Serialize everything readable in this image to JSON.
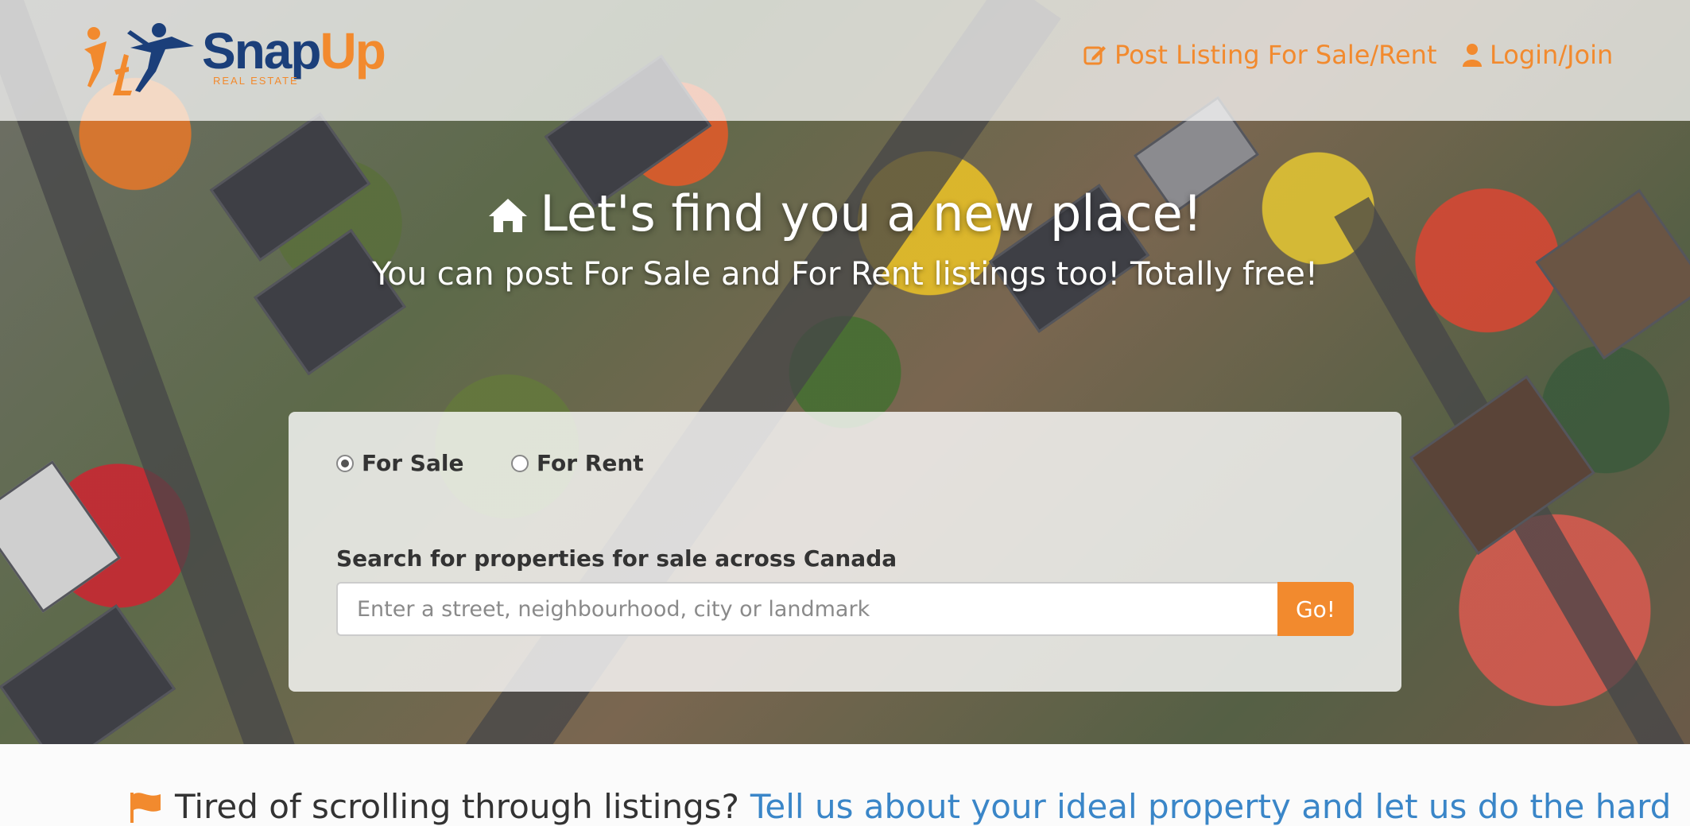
{
  "brand": {
    "name_part1": "Snap",
    "name_part2": "Up",
    "tagline": "REAL ESTATE",
    "primary_color": "#1b3f7a",
    "accent_color": "#f28a2e"
  },
  "nav": {
    "post_listing": {
      "label": "Post Listing For Sale/Rent",
      "icon": "edit-icon"
    },
    "login": {
      "label": "Login/Join",
      "icon": "user-icon"
    }
  },
  "hero": {
    "title": "Let's find you a new place!",
    "title_icon": "home-icon",
    "subtitle": "You can post For Sale and For Rent listings too! Totally free!"
  },
  "search": {
    "options": [
      {
        "label": "For Sale",
        "checked": true
      },
      {
        "label": "For Rent",
        "checked": false
      }
    ],
    "label": "Search for properties for sale across Canada",
    "placeholder": "Enter a street, neighbourhood, city or landmark",
    "value": "",
    "button_label": "Go!"
  },
  "promo": {
    "icon": "flag-icon",
    "text": "Tired of scrolling through listings?",
    "link_text": "Tell us about your ideal property and let us do the hard"
  }
}
